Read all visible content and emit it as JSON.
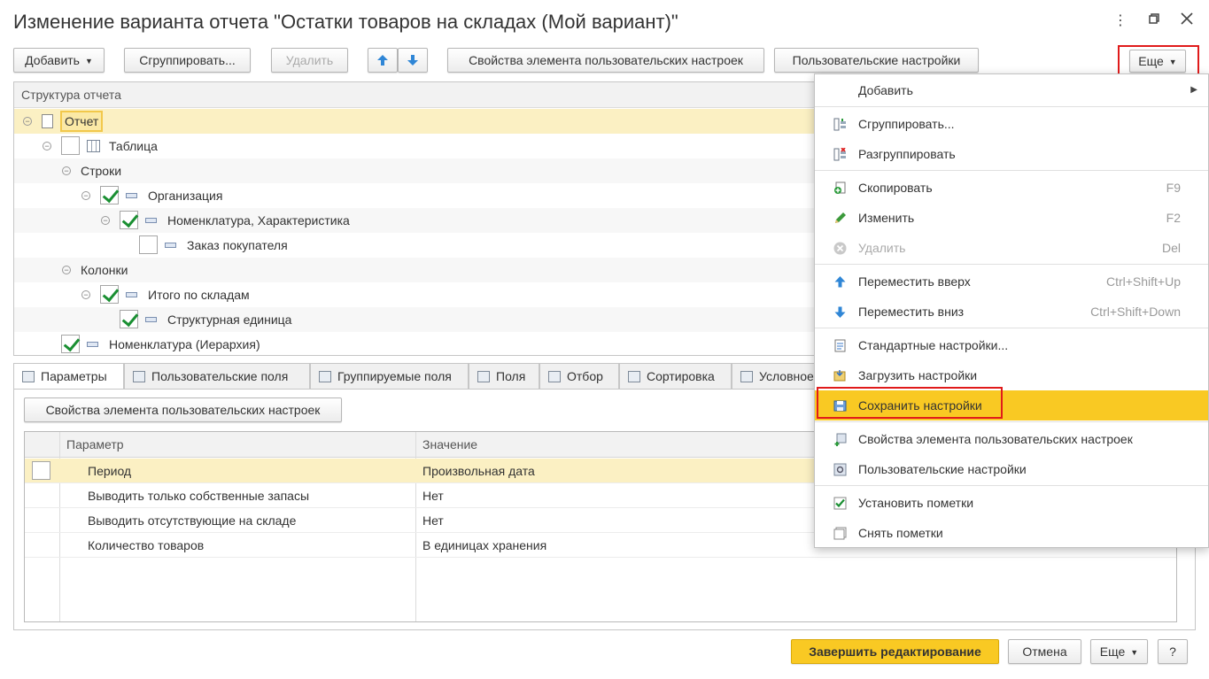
{
  "window": {
    "title": "Изменение варианта отчета \"Остатки товаров на складах (Мой вариант)\"",
    "more_icon": "more-vertical-icon",
    "maximize_icon": "maximize-icon",
    "close_icon": "close-icon"
  },
  "toolbar": {
    "add": "Добавить",
    "group": "Сгруппировать...",
    "delete": "Удалить",
    "item_props": "Свойства элемента пользовательских настроек",
    "user_settings": "Пользовательские настройки",
    "more": "Еще"
  },
  "tree": {
    "header": "Структура отчета",
    "rows": [
      {
        "label": "Отчет",
        "checked": null
      },
      {
        "label": "Таблица",
        "checked": false
      },
      {
        "label": "Строки",
        "checked": null
      },
      {
        "label": "Организация",
        "checked": true
      },
      {
        "label": "Номенклатура, Характеристика",
        "checked": true
      },
      {
        "label": "Заказ покупателя",
        "checked": false
      },
      {
        "label": "Колонки",
        "checked": null
      },
      {
        "label": "Итого по складам",
        "checked": true
      },
      {
        "label": "Структурная единица",
        "checked": true
      },
      {
        "label": "Номенклатура (Иерархия)",
        "checked": true
      }
    ]
  },
  "tabs": [
    {
      "label": "Параметры"
    },
    {
      "label": "Пользовательские поля"
    },
    {
      "label": "Группируемые поля"
    },
    {
      "label": "Поля"
    },
    {
      "label": "Отбор"
    },
    {
      "label": "Сортировка"
    },
    {
      "label": "Условное"
    }
  ],
  "params": {
    "item_props_button": "Свойства элемента пользовательских настроек",
    "col_param": "Параметр",
    "col_value": "Значение",
    "rows": [
      {
        "param": "Период",
        "value": "Произвольная дата"
      },
      {
        "param": "Выводить только собственные запасы",
        "value": "Нет"
      },
      {
        "param": "Выводить отсутствующие на складе",
        "value": "Нет"
      },
      {
        "param": "Количество товаров",
        "value": "В единицах хранения"
      }
    ]
  },
  "menu": {
    "items": [
      {
        "label": "Добавить",
        "shortcut": "",
        "submenu": true
      },
      {
        "label": "Сгруппировать...",
        "shortcut": ""
      },
      {
        "label": "Разгруппировать",
        "shortcut": ""
      },
      {
        "label": "Скопировать",
        "shortcut": "F9"
      },
      {
        "label": "Изменить",
        "shortcut": "F2"
      },
      {
        "label": "Удалить",
        "shortcut": "Del"
      },
      {
        "label": "Переместить вверх",
        "shortcut": "Ctrl+Shift+Up"
      },
      {
        "label": "Переместить вниз",
        "shortcut": "Ctrl+Shift+Down"
      },
      {
        "label": "Стандартные настройки...",
        "shortcut": ""
      },
      {
        "label": "Загрузить настройки",
        "shortcut": ""
      },
      {
        "label": "Сохранить настройки",
        "shortcut": ""
      },
      {
        "label": "Свойства элемента пользовательских настроек",
        "shortcut": ""
      },
      {
        "label": "Пользовательские настройки",
        "shortcut": ""
      },
      {
        "label": "Установить пометки",
        "shortcut": ""
      },
      {
        "label": "Снять пометки",
        "shortcut": ""
      }
    ]
  },
  "footer": {
    "finish": "Завершить редактирование",
    "cancel": "Отмена",
    "more": "Еще",
    "help": "?"
  },
  "colors": {
    "accent_yellow": "#f9c923",
    "selection": "#fbf0c3",
    "highlight_red": "#e01b1b",
    "check_green": "#1a8f32"
  }
}
